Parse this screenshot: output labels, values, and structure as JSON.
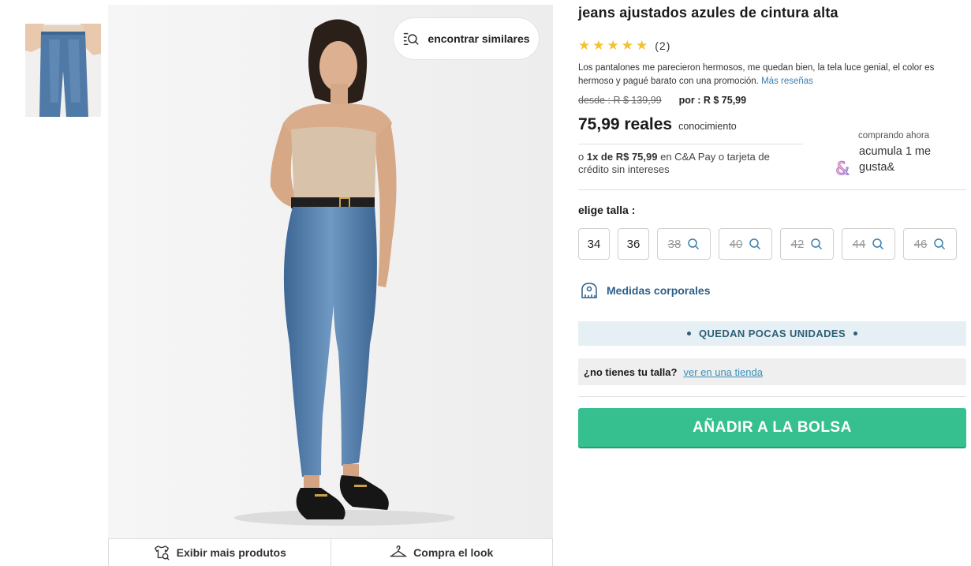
{
  "gallery": {
    "find_similar_label": "encontrar similares",
    "bottom_bar": {
      "more_products_label": "Exibir mais produtos",
      "shop_look_label": "Compra el look"
    }
  },
  "product": {
    "title": "jeans ajustados azules de cintura alta",
    "rating": {
      "stars": 5,
      "count_text": "(2)"
    },
    "review_text": "Los pantalones me parecieron hermosos, me quedan bien, la tela luce genial, el color es hermoso y pagué barato con una promoción.",
    "more_reviews_label": "Más reseñas",
    "old_price_text": "desde : R $ 139,99",
    "new_price_text": "por : R $ 75,99",
    "big_price": "75,99 reales",
    "big_price_note": "conocimiento",
    "installment": {
      "prefix": "o",
      "bold": "1x de R$ 75,99",
      "suffix": "en C&A Pay o tarjeta de crédito sin intereses"
    },
    "promo": {
      "small_text": "comprando ahora",
      "body_text": "acumula 1 me gusta&",
      "icon": "ampersand-icon"
    }
  },
  "sizes": {
    "label": "elige talla :",
    "options": [
      {
        "value": "34",
        "available": true
      },
      {
        "value": "36",
        "available": true
      },
      {
        "value": "38",
        "available": false
      },
      {
        "value": "40",
        "available": false
      },
      {
        "value": "42",
        "available": false
      },
      {
        "value": "44",
        "available": false
      },
      {
        "value": "46",
        "available": false
      }
    ]
  },
  "measures_label": "Medidas corporales",
  "stock_banner": "QUEDAN POCAS UNIDADES",
  "store": {
    "question": "¿no tienes tu talla?",
    "link_label": "ver en una tienda"
  },
  "add_to_bag_label": "AÑADIR A LA BOLSA",
  "colors": {
    "accent_green": "#36c090",
    "star_yellow": "#f2c230",
    "link_blue": "#3b7fb0",
    "banner_bg": "#e6eff3"
  }
}
